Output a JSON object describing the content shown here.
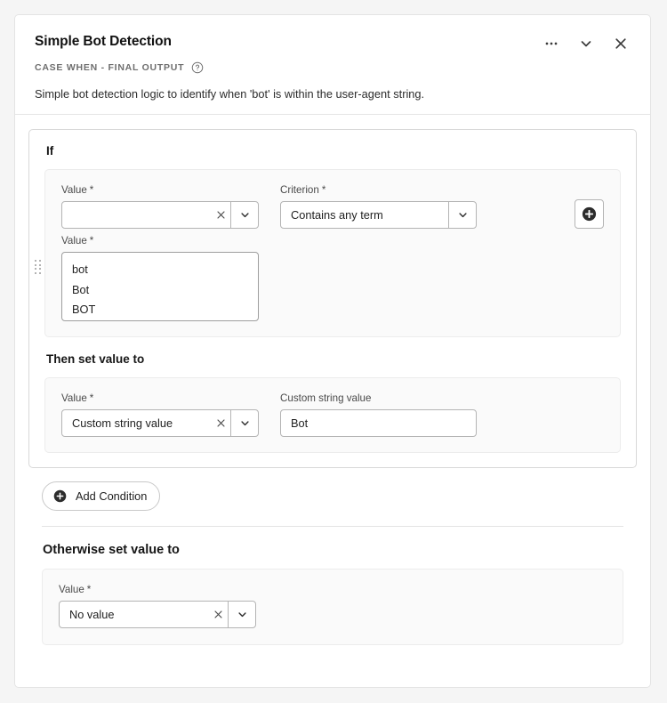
{
  "card": {
    "title": "Simple Bot Detection",
    "subtitle": "CASE WHEN - FINAL OUTPUT",
    "help_icon": "help-circle-icon",
    "description": "Simple bot detection logic to identify when 'bot' is within the user-agent string.",
    "actions": [
      {
        "name": "more-options",
        "icon": "ellipsis-icon"
      },
      {
        "name": "collapse",
        "icon": "chevron-down-icon"
      },
      {
        "name": "close",
        "icon": "close-icon"
      }
    ]
  },
  "condition": {
    "if_heading": "If",
    "value_label": "Value",
    "value_required": "*",
    "value_selected": "",
    "criterion_label": "Criterion",
    "criterion_required": "*",
    "criterion_selected": "Contains any term",
    "terms_label": "Value",
    "terms_required": "*",
    "terms": "bot\nBot\nBOT",
    "add_row_icon": "plus-circle-icon",
    "drag_handle_icon": "drag-handle-icon",
    "then_heading": "Then set value to",
    "then_value_label": "Value",
    "then_value_required": "*",
    "then_value_selected": "Custom string value",
    "custom_string_label": "Custom string value",
    "custom_string_value": "Bot"
  },
  "add_condition": {
    "label": "Add Condition",
    "icon": "plus-circle-icon"
  },
  "otherwise": {
    "heading": "Otherwise set value to",
    "value_label": "Value",
    "value_required": "*",
    "value_selected": "No value"
  },
  "colors": {
    "page_background": "#f5f5f5",
    "card_background": "#ffffff",
    "panel_background": "#fafafa",
    "border": "#e4e4e4",
    "text_primary": "#1f1f1f",
    "text_muted": "#6e6e6e"
  }
}
